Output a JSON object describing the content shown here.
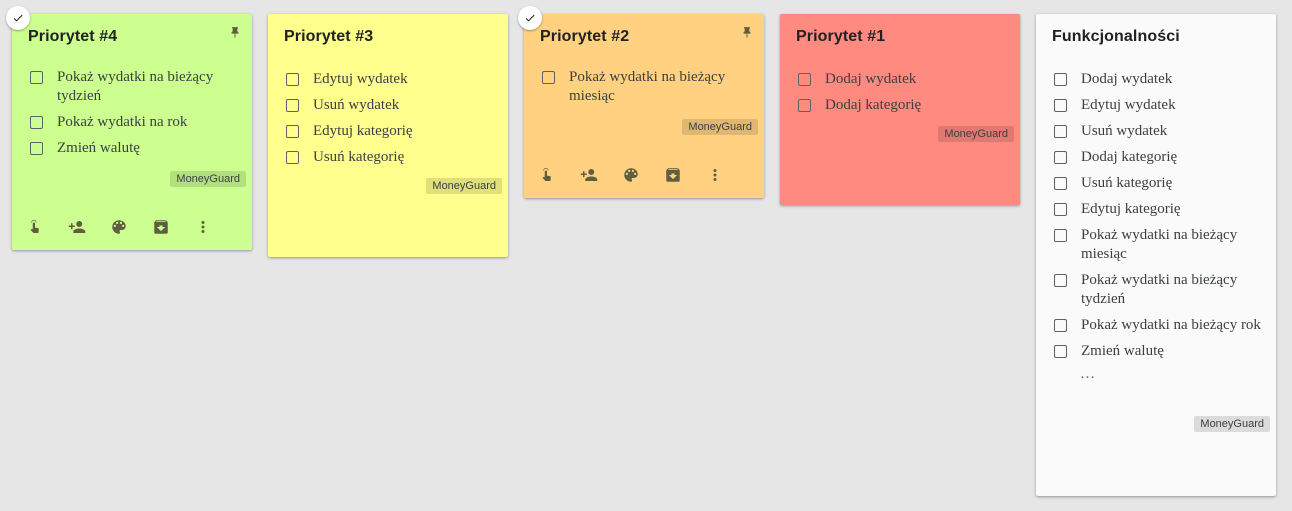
{
  "notes": [
    {
      "title": "Priorytet #4",
      "color": "#ccff90",
      "pinned": true,
      "selected": true,
      "items": [
        "Pokaż wydatki na bieżący tydzień",
        "Pokaż wydatki na rok",
        "Zmień walutę"
      ],
      "label": "MoneyGuard"
    },
    {
      "title": "Priorytet #3",
      "color": "#ffff8d",
      "pinned": false,
      "selected": false,
      "items": [
        "Edytuj wydatek",
        "Usuń wydatek",
        "Edytuj kategorię",
        "Usuń kategorię"
      ],
      "label": "MoneyGuard"
    },
    {
      "title": "Priorytet #2",
      "color": "#ffd180",
      "pinned": true,
      "selected": true,
      "items": [
        "Pokaż wydatki na bieżący miesiąc"
      ],
      "label": "MoneyGuard"
    },
    {
      "title": "Priorytet #1",
      "color": "#ff8a80",
      "pinned": false,
      "selected": false,
      "items": [
        "Dodaj wydatek",
        "Dodaj kategorię"
      ],
      "label": "MoneyGuard"
    },
    {
      "title": "Funkcjonalności",
      "color": "#fafafa",
      "pinned": false,
      "selected": false,
      "items": [
        "Dodaj wydatek",
        "Edytuj wydatek",
        "Usuń wydatek",
        "Dodaj kategorię",
        "Usuń kategorię",
        "Edytuj kategorię",
        "Pokaż wydatki na bieżący miesiąc",
        "Pokaż wydatki na bieżący tydzień",
        "Pokaż wydatki na bieżący rok",
        "Zmień walutę"
      ],
      "ellipsis": "…",
      "label": "MoneyGuard"
    }
  ],
  "toolbar_icons": [
    "reminder-icon",
    "collaborator-icon",
    "palette-icon",
    "archive-icon",
    "more-icon"
  ]
}
